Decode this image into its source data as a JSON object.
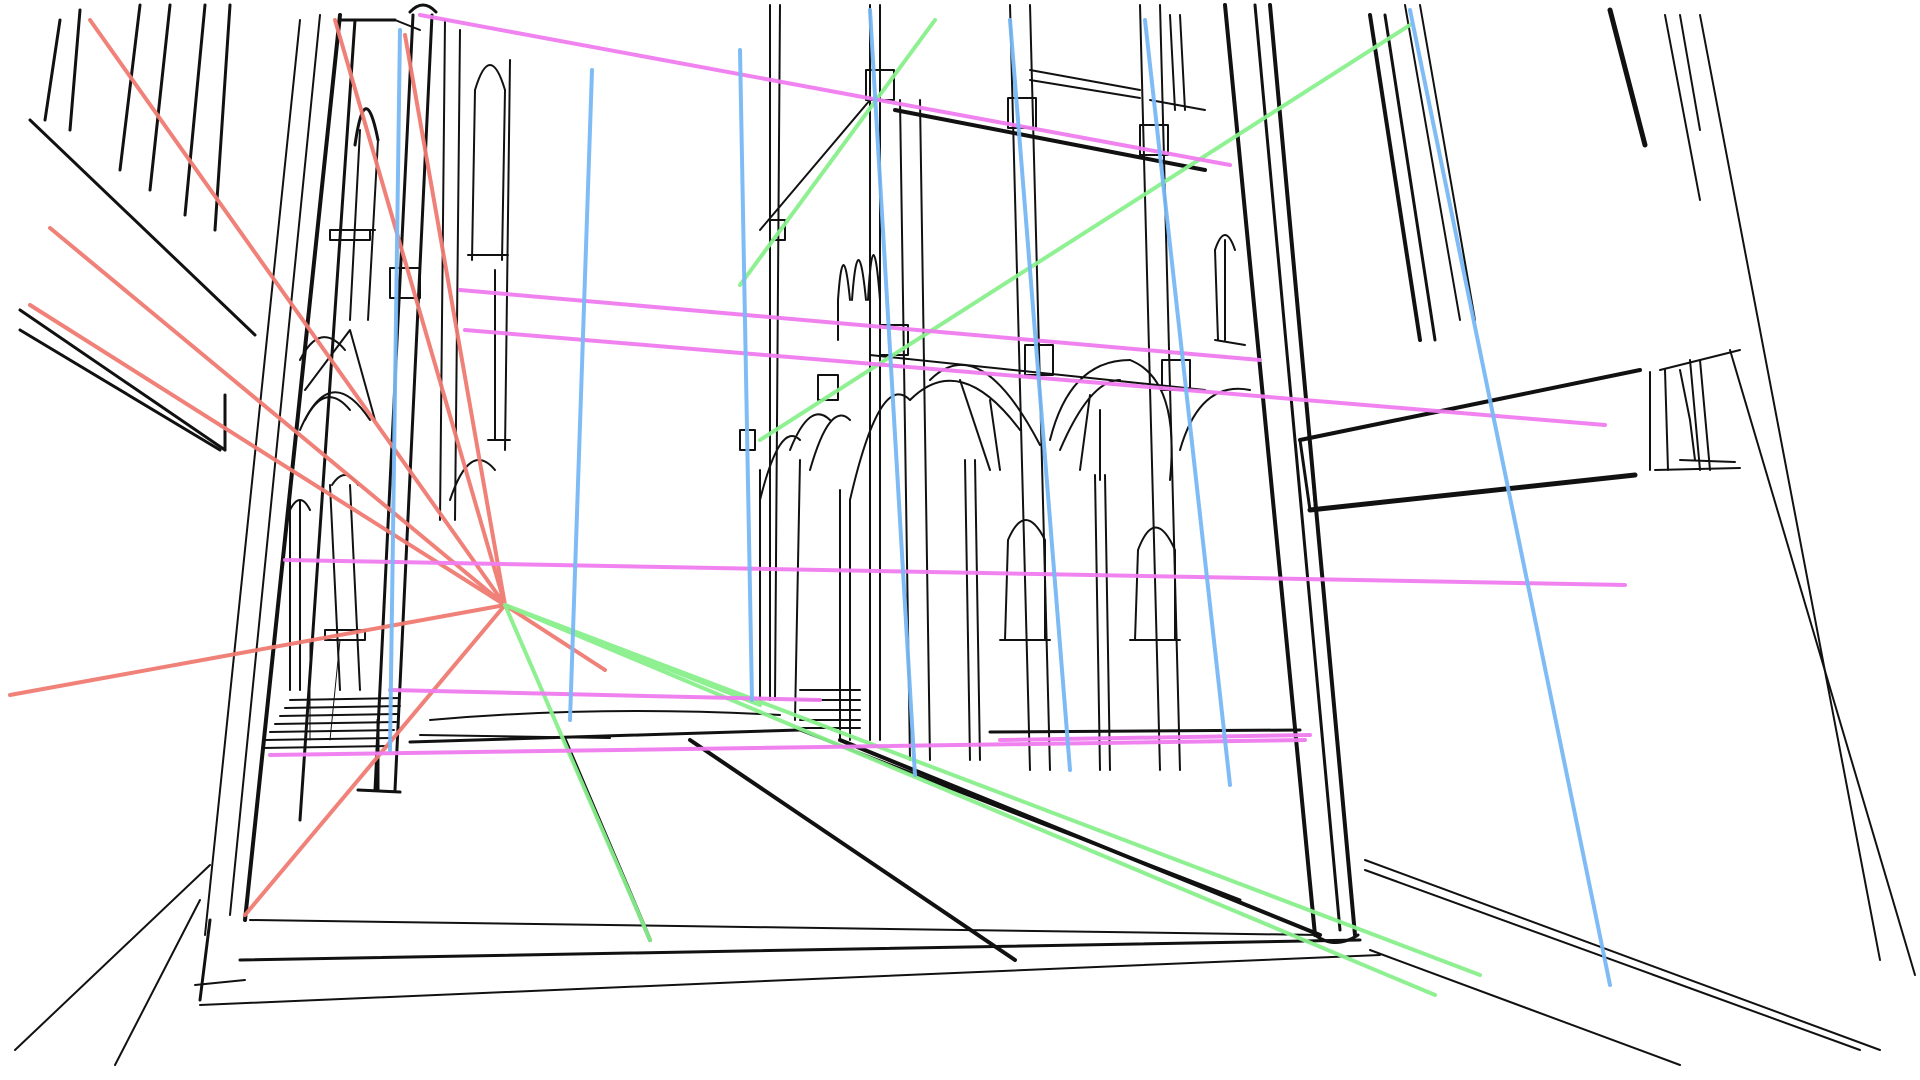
{
  "image": {
    "kind": "perspective-sketch",
    "subject": "gothic-cathedral-interior",
    "background": "#ffffff"
  },
  "guide_sets": [
    {
      "name": "red-vanishing-rays",
      "color": "#f07b72",
      "role": "vanishing point rays"
    },
    {
      "name": "green-floor-rays",
      "color": "#88f08c",
      "role": "floor perspective rays"
    },
    {
      "name": "magenta-horizontals",
      "color": "#f07cf0",
      "role": "near-horizontal guide lines"
    },
    {
      "name": "blue-verticals",
      "color": "#78b8f5",
      "role": "vertical guide lines"
    }
  ],
  "ink": {
    "color": "#111111"
  }
}
